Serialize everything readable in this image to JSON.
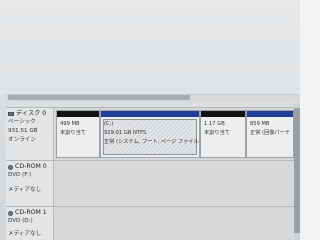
{
  "colors": {
    "unallocated_bar": "#111111",
    "primary_bar": "#1f3f9a"
  },
  "disks": [
    {
      "title": "ディスク 0",
      "type": "ベーシック",
      "size": "931.51 GB",
      "status": "オンライン",
      "partitions": [
        {
          "name": "",
          "size": "499 MB",
          "status": "未割り当て",
          "bar": "unallocated"
        },
        {
          "name": "(C:)",
          "size": "929.01 GB NTFS",
          "status": "正常 (システム, ブート, ページ ファイル,",
          "bar": "primary"
        },
        {
          "name": "",
          "size": "1.17 GB",
          "status": "未割り当て",
          "bar": "unallocated"
        },
        {
          "name": "",
          "size": "859 MB",
          "status": "正常 (回復パーテ",
          "bar": "primary"
        }
      ]
    },
    {
      "title": "CD-ROM 0",
      "type": "DVD (F:)",
      "status": "メディアなし"
    },
    {
      "title": "CD-ROM 1",
      "type": "DVD (D:)",
      "status": "メディアなし"
    }
  ]
}
